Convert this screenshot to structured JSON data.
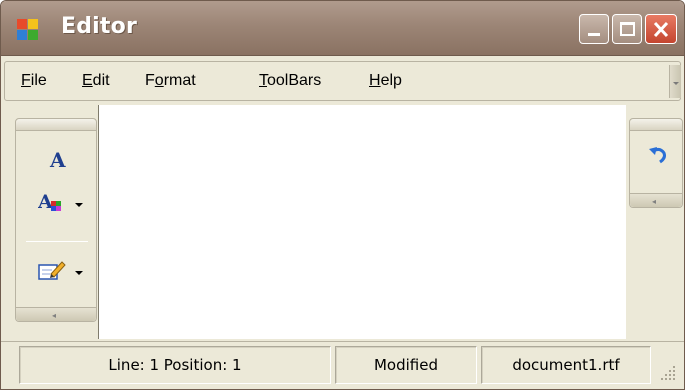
{
  "window": {
    "title": "Editor",
    "title_bar_color": "#9c8576",
    "app_icon": "editor-app-icon",
    "controls": {
      "minimize_icon": "minimize-icon",
      "maximize_icon": "maximize-icon",
      "close_icon": "close-icon"
    }
  },
  "menu": {
    "items": [
      {
        "label": "File",
        "mnemonic": "F"
      },
      {
        "label": "Edit",
        "mnemonic": "E"
      },
      {
        "label": "Format",
        "mnemonic": "o"
      },
      {
        "label": "ToolBars",
        "mnemonic": "T"
      },
      {
        "label": "Help",
        "mnemonic": "H"
      }
    ]
  },
  "left_toolbar": {
    "buttons": [
      {
        "icon": "font-icon"
      },
      {
        "icon": "font-color-icon",
        "has_dropdown": true
      },
      {
        "icon": "edit-note-icon",
        "has_dropdown": true
      }
    ],
    "overflow_glyph": "◂"
  },
  "right_toolbar": {
    "buttons": [
      {
        "icon": "undo-icon"
      }
    ],
    "overflow_glyph": "◂"
  },
  "status": {
    "position": "Line: 1  Position: 1",
    "state": "Modified",
    "file": "document1.rtf"
  }
}
